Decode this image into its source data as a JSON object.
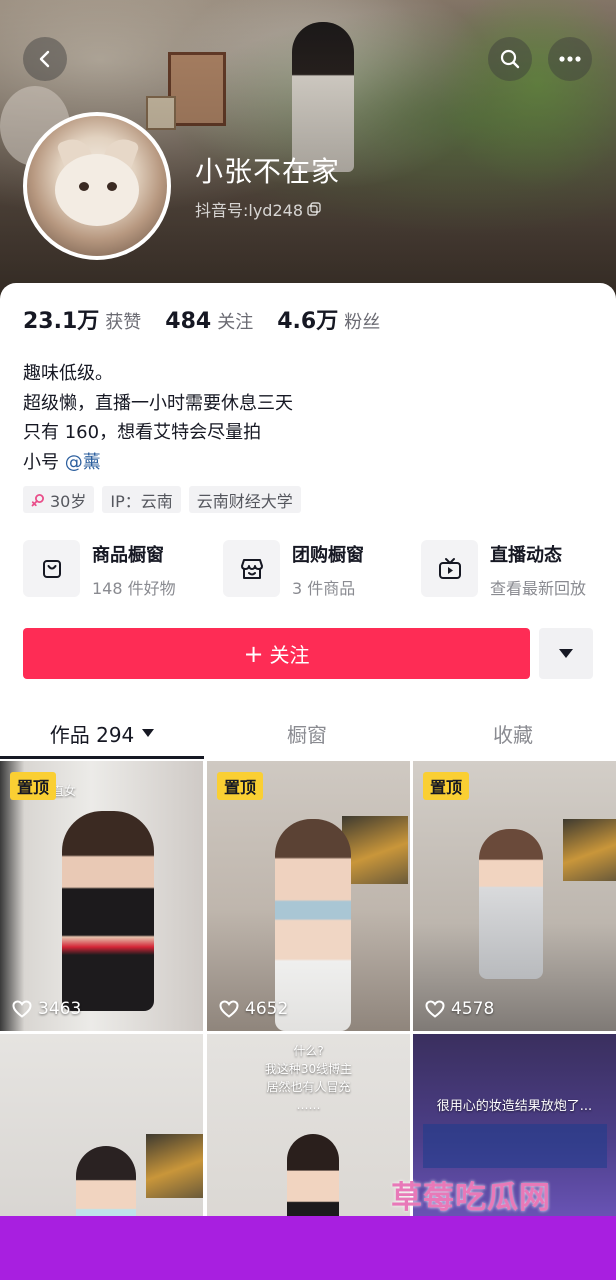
{
  "profile": {
    "nickname": "小张不在家",
    "douyin_id": "抖音号:lyd248",
    "stats": [
      {
        "value": "23.1万",
        "label": "获赞"
      },
      {
        "value": "484",
        "label": "关注"
      },
      {
        "value": "4.6万",
        "label": "粉丝"
      }
    ],
    "bio": {
      "line1": "趣味低级。",
      "line2": "超级懒，直播一小时需要休息三天",
      "line3": "只有 160，想看艾特会尽量拍",
      "line4_prefix": "小号 ",
      "line4_mention": "@薰"
    },
    "tags": {
      "age": "30岁",
      "ip": "IP：云南",
      "school": "云南财经大学"
    }
  },
  "features": [
    {
      "title": "商品橱窗",
      "subtitle": "148 件好物",
      "icon": "bag-icon"
    },
    {
      "title": "团购橱窗",
      "subtitle": "3 件商品",
      "icon": "store-icon"
    },
    {
      "title": "直播动态",
      "subtitle": "查看最新回放",
      "icon": "tv-icon"
    }
  ],
  "actions": {
    "follow_label": "关注",
    "follow_plus": "+"
  },
  "tabs": {
    "works": "作品 294",
    "showcase": "橱窗",
    "favorites": "收藏"
  },
  "videos": [
    {
      "pinned": "置顶",
      "likes": "3463",
      "caption": "女直女"
    },
    {
      "pinned": "置顶",
      "likes": "4652"
    },
    {
      "pinned": "置顶",
      "likes": "4578"
    },
    {},
    {
      "caption_lines": [
        "什么?",
        "我这种30线博主",
        "居然也有人冒充",
        "……"
      ]
    },
    {
      "caption": "很用心的妆造结果放炮了..."
    }
  ],
  "watermark": "草莓吃瓜网",
  "colors": {
    "follow_button": "#fe2c55",
    "pin_badge": "#facf33",
    "mention": "#2c5f9e",
    "bottom_bar": "#a81fe0",
    "age_tag_icon": "#e94f8a"
  }
}
